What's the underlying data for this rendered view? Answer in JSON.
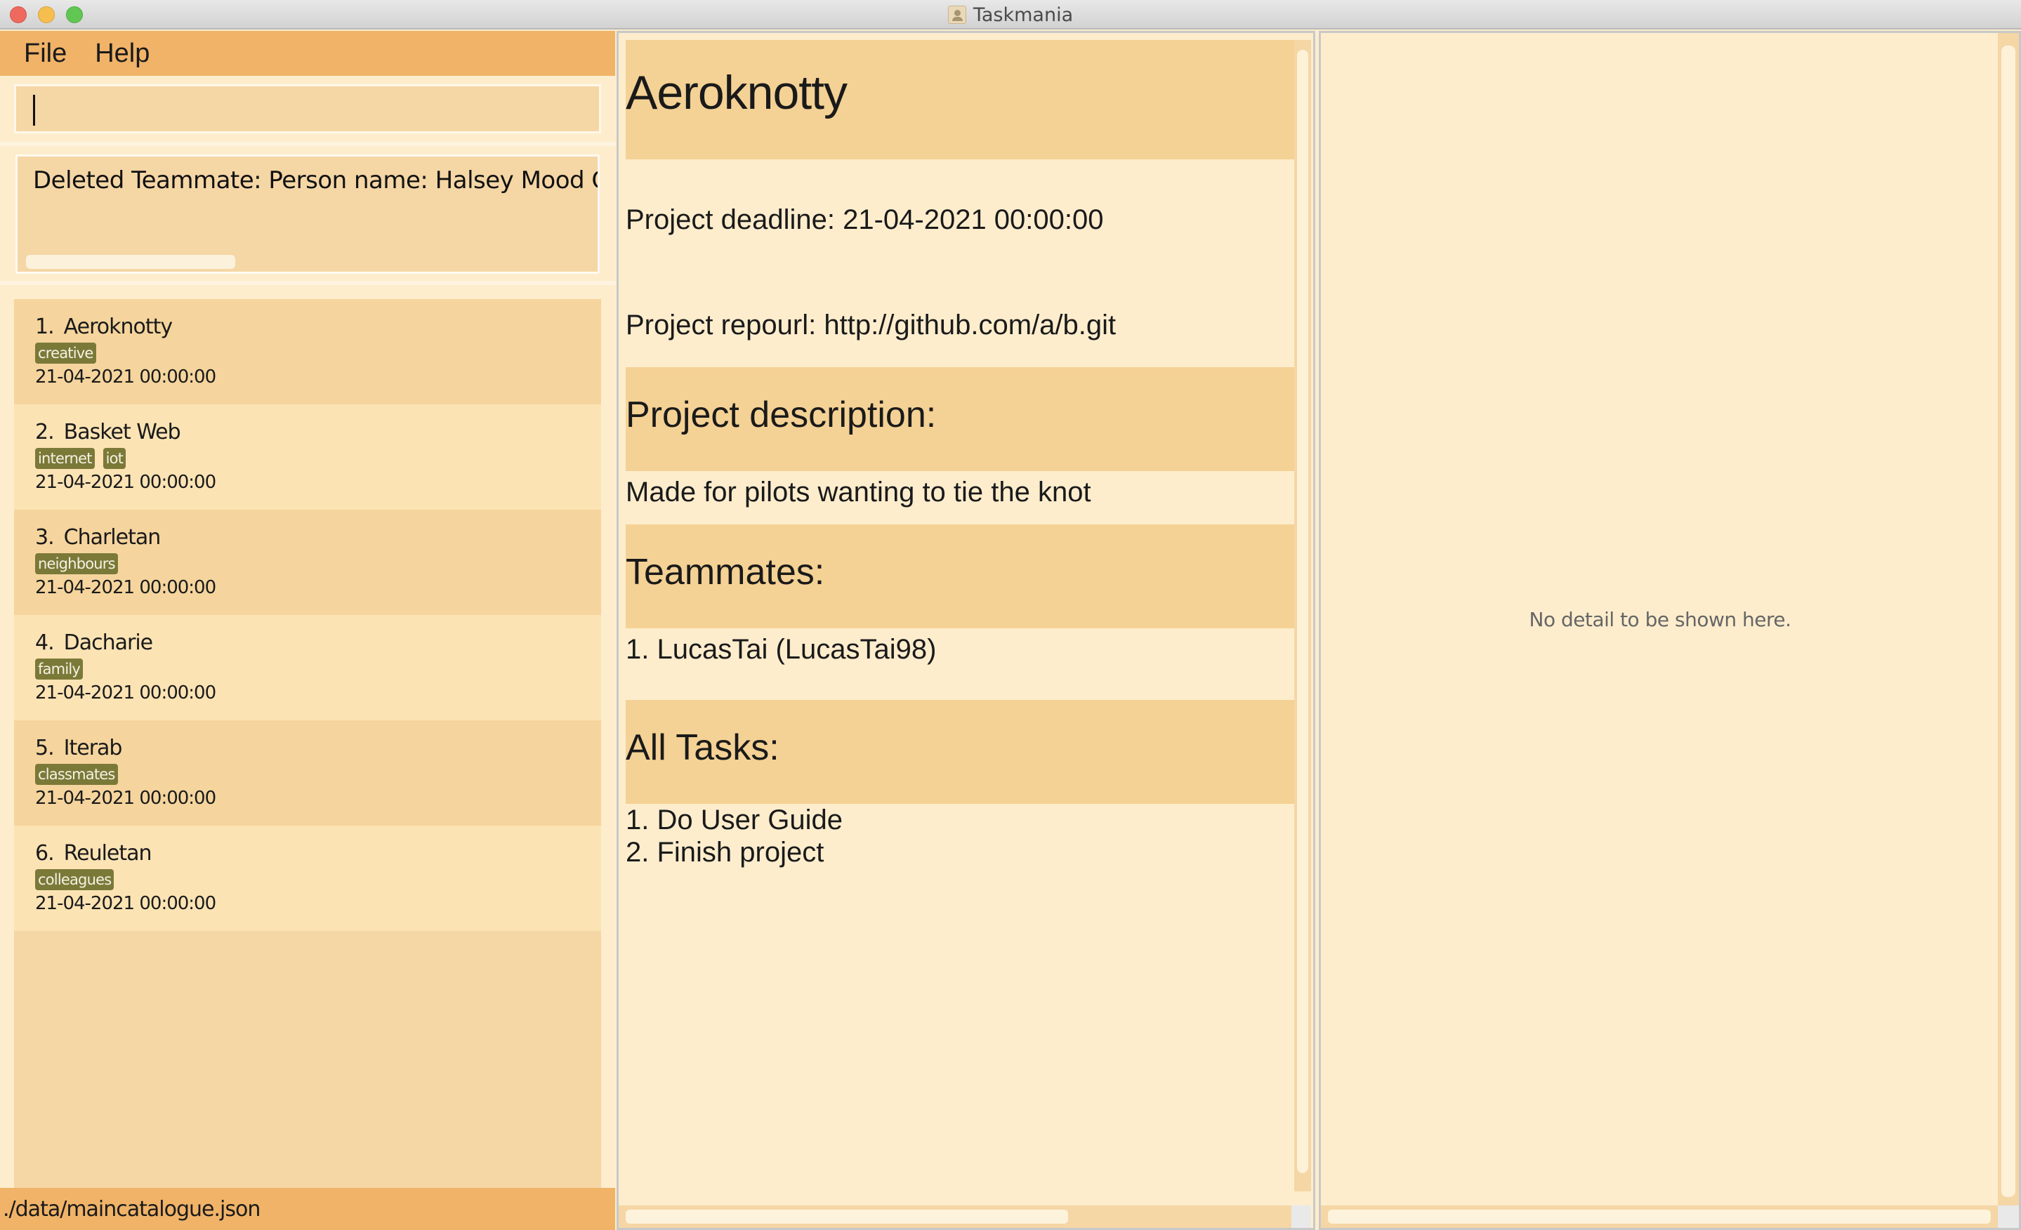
{
  "window": {
    "title": "Taskmania",
    "app_icon": "person-card-icon"
  },
  "menu": {
    "items": [
      {
        "label": "File"
      },
      {
        "label": "Help"
      }
    ]
  },
  "command": {
    "value": "",
    "placeholder": ""
  },
  "result": {
    "text": "Deleted Teammate:  Person name: Halsey Mood Git Username: ..."
  },
  "projects": [
    {
      "index": "1.",
      "name": "Aeroknotty",
      "tags": [
        "creative"
      ],
      "deadline": "21-04-2021 00:00:00"
    },
    {
      "index": "2.",
      "name": "Basket Web",
      "tags": [
        "internet",
        "iot"
      ],
      "deadline": "21-04-2021 00:00:00"
    },
    {
      "index": "3.",
      "name": "Charletan",
      "tags": [
        "neighbours"
      ],
      "deadline": "21-04-2021 00:00:00"
    },
    {
      "index": "4.",
      "name": "Dacharie",
      "tags": [
        "family"
      ],
      "deadline": "21-04-2021 00:00:00"
    },
    {
      "index": "5.",
      "name": "Iterab",
      "tags": [
        "classmates"
      ],
      "deadline": "21-04-2021 00:00:00"
    },
    {
      "index": "6.",
      "name": "Reuletan",
      "tags": [
        "colleagues"
      ],
      "deadline": "21-04-2021 00:00:00"
    }
  ],
  "status_bar": {
    "path": "./data/maincatalogue.json"
  },
  "project_detail": {
    "name": "Aeroknotty",
    "deadline_label": "Project deadline: 21-04-2021 00:00:00",
    "repourl_label": "Project repourl: http://github.com/a/b.git",
    "description_heading": "Project description:",
    "description": "Made for pilots wanting to tie the knot",
    "teammates_heading": "Teammates:",
    "teammates": [
      "1. LucasTai (LucasTai98)"
    ],
    "tasks_heading": "All Tasks:",
    "tasks": [
      "1. Do User Guide",
      "2. Finish project"
    ]
  },
  "detail_panel": {
    "empty_message": "No detail to be shown here."
  },
  "colors": {
    "menu_bar": "#F0B368",
    "background": "#FDEDCD",
    "card_dark": "#F5D59D",
    "card_light": "#FCE3B4",
    "tag": "#7B7938",
    "section_heading": "#F4D194"
  }
}
